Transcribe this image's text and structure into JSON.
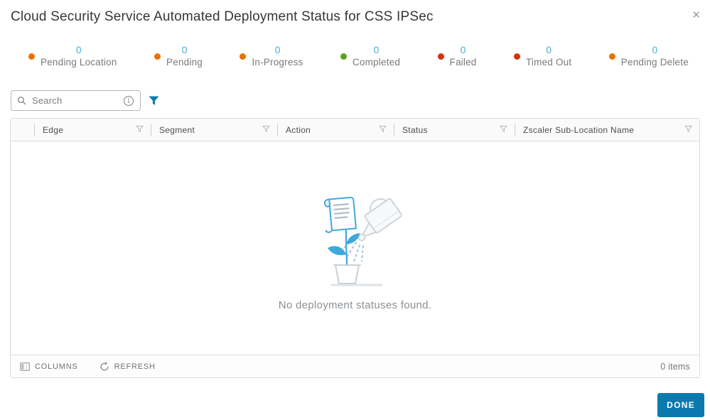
{
  "dialog": {
    "title": "Cloud Security Service Automated Deployment Status for CSS IPSec",
    "close_label": "✕"
  },
  "status_summary": {
    "items": [
      {
        "label": "Pending Location",
        "count": "0",
        "dot_color": "#EA7100"
      },
      {
        "label": "Pending",
        "count": "0",
        "dot_color": "#EA7100"
      },
      {
        "label": "In-Progress",
        "count": "0",
        "dot_color": "#EA7100"
      },
      {
        "label": "Completed",
        "count": "0",
        "dot_color": "#5AA220"
      },
      {
        "label": "Failed",
        "count": "0",
        "dot_color": "#D5310E"
      },
      {
        "label": "Timed Out",
        "count": "0",
        "dot_color": "#D5310E"
      },
      {
        "label": "Pending Delete",
        "count": "0",
        "dot_color": "#EA7100"
      }
    ]
  },
  "toolbar": {
    "search_placeholder": "Search"
  },
  "table": {
    "columns": [
      {
        "label": "Edge"
      },
      {
        "label": "Segment"
      },
      {
        "label": "Action"
      },
      {
        "label": "Status"
      },
      {
        "label": "Zscaler Sub-Location Name"
      }
    ],
    "empty_message": "No deployment statuses found."
  },
  "footer": {
    "columns_label": "COLUMNS",
    "refresh_label": "REFRESH",
    "items_count": "0 items"
  },
  "actions": {
    "done_label": "DONE"
  },
  "colors": {
    "accent_blue": "#0C79AE",
    "count_blue": "#49AFD9",
    "dot_orange": "#EA7100",
    "dot_green": "#5AA220",
    "dot_red": "#D5310E"
  }
}
